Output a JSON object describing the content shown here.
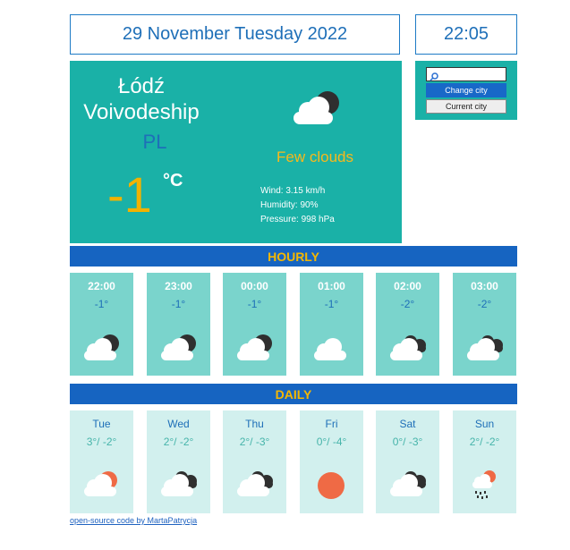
{
  "header": {
    "date": "29 November Tuesday 2022",
    "time": "22:05"
  },
  "current": {
    "city": "Łódź Voivodeship",
    "country": "PL",
    "temperature": "-1",
    "unit": "°C",
    "condition": "Few clouds",
    "wind": "Wind: 3.15 km/h",
    "humidity": "Humidity: 90%",
    "pressure": "Pressure: 998 hPa",
    "icon": "few-clouds-night-icon"
  },
  "search": {
    "placeholder": "",
    "change_label": "Change city",
    "current_label": "Current city"
  },
  "hourly_title": "HOURLY",
  "hourly": [
    {
      "time": "22:00",
      "temp": "-1°",
      "icon": "cloud-moon"
    },
    {
      "time": "23:00",
      "temp": "-1°",
      "icon": "cloud-moon"
    },
    {
      "time": "00:00",
      "temp": "-1°",
      "icon": "cloud-moon"
    },
    {
      "time": "01:00",
      "temp": "-1°",
      "icon": "cloud"
    },
    {
      "time": "02:00",
      "temp": "-2°",
      "icon": "cloud-dark"
    },
    {
      "time": "03:00",
      "temp": "-2°",
      "icon": "cloud-dark"
    }
  ],
  "daily_title": "DAILY",
  "daily": [
    {
      "day": "Tue",
      "range": "3°/ -2°",
      "icon": "cloud-sun"
    },
    {
      "day": "Wed",
      "range": "2°/ -2°",
      "icon": "cloud-dark"
    },
    {
      "day": "Thu",
      "range": "2°/ -3°",
      "icon": "cloud-dark"
    },
    {
      "day": "Fri",
      "range": "0°/ -4°",
      "icon": "sun"
    },
    {
      "day": "Sat",
      "range": "0°/ -3°",
      "icon": "cloud-dark"
    },
    {
      "day": "Sun",
      "range": "2°/ -2°",
      "icon": "rain-sun"
    }
  ],
  "footer": {
    "link": "open-source code by MartaPatrycja"
  },
  "colors": {
    "teal": "#1ab1a7",
    "blue": "#1664c1",
    "yellow": "#f5b700",
    "light_teal": "#7ad4cc",
    "pale_teal": "#d2f0ee"
  }
}
